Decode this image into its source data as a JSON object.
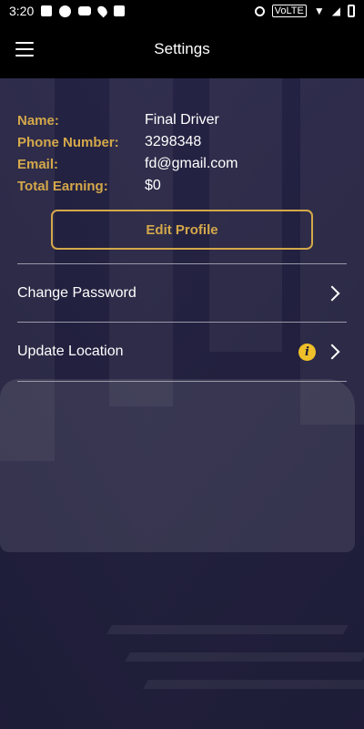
{
  "status_bar": {
    "time": "3:20",
    "network": "VoLTE"
  },
  "app_bar": {
    "title": "Settings",
    "menu_icon": "hamburger-icon"
  },
  "profile": {
    "fields": [
      {
        "label": "Name:",
        "value": "Final Driver"
      },
      {
        "label": "Phone Number:",
        "value": "3298348"
      },
      {
        "label": "Email:",
        "value": "fd@gmail.com"
      },
      {
        "label": "Total Earning:",
        "value": "$0"
      }
    ],
    "edit_button_label": "Edit Profile"
  },
  "menu": {
    "items": [
      {
        "label": "Change Password",
        "icon": "chevron-right-icon"
      },
      {
        "label": "Update Location",
        "icon": "chevron-right-icon",
        "badge_icon": "info-icon",
        "badge_text": "i"
      }
    ]
  },
  "colors": {
    "accent": "#d4a84a",
    "background": "#1c1b33",
    "appbar": "#000000",
    "info_badge": "#f0c02a"
  }
}
